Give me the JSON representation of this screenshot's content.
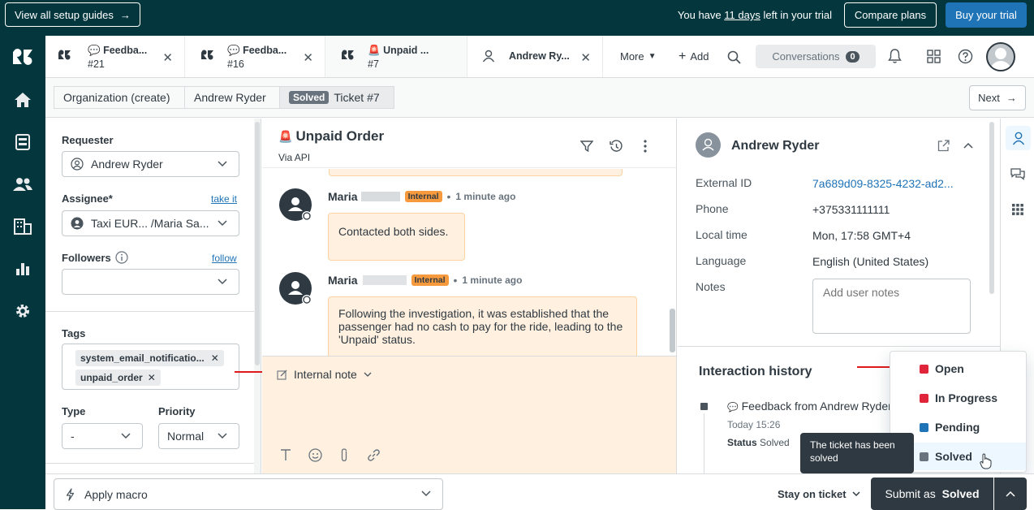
{
  "topbar": {
    "setup_guides": "View all setup guides",
    "trial_prefix": "You have ",
    "trial_days": "11 days",
    "trial_suffix": " left in your trial",
    "compare_plans": "Compare plans",
    "buy_trial": "Buy your trial"
  },
  "tabs": [
    {
      "title": "Feedba...",
      "sub": "#21"
    },
    {
      "title": "Feedba...",
      "sub": "#16"
    },
    {
      "title": "Unpaid ...",
      "sub": "#7"
    },
    {
      "title": "Andrew Ry..."
    }
  ],
  "tabbar": {
    "more": "More",
    "add": "Add",
    "conversations": "Conversations",
    "conversations_count": "0"
  },
  "breadcrumb": {
    "org": "Organization (create)",
    "user": "Andrew Ryder",
    "status_badge": "Solved",
    "ticket": "Ticket #7",
    "next": "Next"
  },
  "props": {
    "requester_label": "Requester",
    "requester_value": "Andrew Ryder",
    "assignee_label": "Assignee*",
    "assignee_link": "take it",
    "assignee_value": "Taxi EUR... /Maria Sa...",
    "followers_label": "Followers",
    "followers_link": "follow",
    "tags_label": "Tags",
    "tags": [
      "system_email_notificatio...",
      "unpaid_order"
    ],
    "type_label": "Type",
    "type_value": "-",
    "priority_label": "Priority",
    "priority_value": "Normal"
  },
  "ticket": {
    "title": "Unpaid Order",
    "via": "Via API"
  },
  "messages": [
    {
      "author": "Maria",
      "badge": "Internal",
      "time": "1 minute ago",
      "text": "Contacted both sides."
    },
    {
      "author": "Maria",
      "badge": "Internal",
      "time": "1 minute ago",
      "text": "Following the investigation, it was established that the passenger had no cash to pay for the ride, leading to the 'Unpaid' status."
    }
  ],
  "composer": {
    "mode": "Internal note"
  },
  "user_panel": {
    "name": "Andrew Ryder",
    "external_id_label": "External ID",
    "external_id_value": "7a689d09-8325-4232-ad2...",
    "phone_label": "Phone",
    "phone_value": "+375331111111",
    "local_time_label": "Local time",
    "local_time_value": "Mon, 17:58 GMT+4",
    "language_label": "Language",
    "language_value": "English (United States)",
    "notes_label": "Notes",
    "notes_placeholder": "Add user notes",
    "interaction_history": "Interaction history",
    "history_item_title": "Feedback from Andrew Ryder",
    "history_item_time": "Today 15:26",
    "history_item_status_label": "Status",
    "history_item_status_value": "Solved"
  },
  "status_menu": [
    {
      "label": "Open",
      "color": "#e0243a"
    },
    {
      "label": "In Progress",
      "color": "#e0243a"
    },
    {
      "label": "Pending",
      "color": "#1f73b7"
    },
    {
      "label": "Solved",
      "color": "#68737d"
    }
  ],
  "tooltip": "The ticket has been solved",
  "footer": {
    "apply_macro": "Apply macro",
    "stay_on_ticket": "Stay on ticket",
    "submit_prefix": "Submit as ",
    "submit_status": "Solved"
  },
  "colors": {
    "topbar": "#03363d",
    "accent": "#1f73b7",
    "internal_bg": "#fff0df",
    "arrow_red": "#e01a1a"
  }
}
